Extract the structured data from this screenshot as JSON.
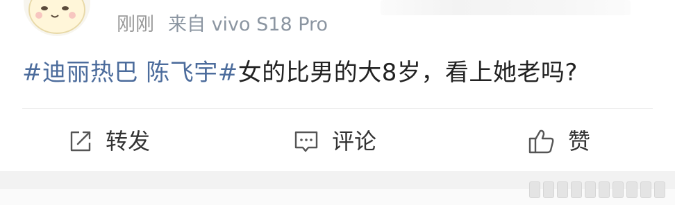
{
  "post": {
    "time": "刚刚",
    "source": "来自 vivo S18 Pro",
    "content": {
      "topic": "#迪丽热巴 陈飞宇#",
      "text": "女的比男的大8岁，看上她老吗?"
    }
  },
  "actions": {
    "repost": {
      "label": "转发",
      "icon": "share-icon"
    },
    "comment": {
      "label": "评论",
      "icon": "comment-icon"
    },
    "like": {
      "label": "赞",
      "icon": "thumbs-up-icon"
    }
  },
  "colors": {
    "topic_link": "#4c6c9c",
    "meta_text": "#999999",
    "body_text": "#222222",
    "footer_bg": "#f2f2f2"
  }
}
